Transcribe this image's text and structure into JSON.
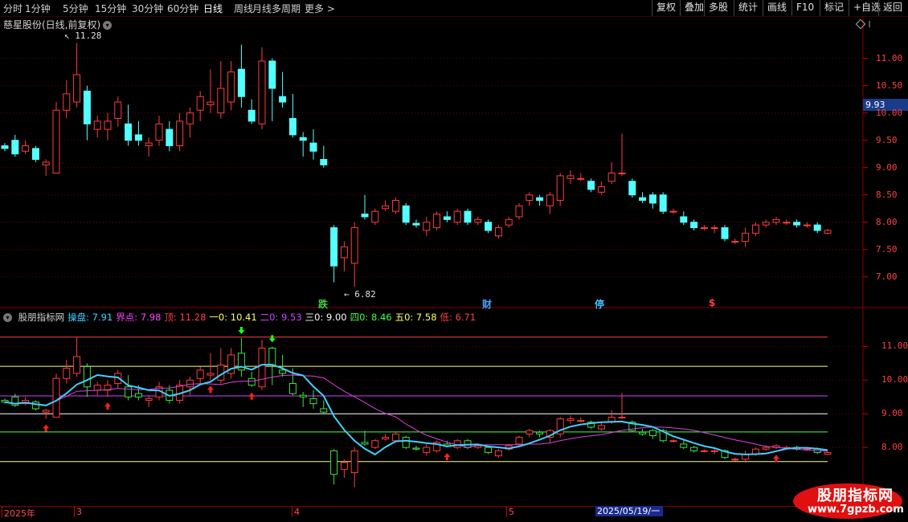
{
  "toolbar": {
    "periods": [
      "分时",
      "1分钟",
      "5分钟",
      "15分钟",
      "30分钟",
      "60分钟",
      "日线",
      "周线",
      "月线",
      "多周期",
      "更多 >"
    ],
    "active_period": "日线",
    "right_buttons": [
      "复权",
      "叠加",
      "多股",
      "统计",
      "画线",
      "F10",
      "标记",
      "+自选",
      "返回"
    ]
  },
  "main_chart": {
    "title": "慈星股份(日线,前复权)",
    "high_marker": "11.28",
    "low_marker": "6.82",
    "current_price": "9.93",
    "y_ticks": [
      "11.00",
      "10.50",
      "10.00",
      "9.50",
      "9.00",
      "8.50",
      "8.00",
      "7.50",
      "7.00"
    ],
    "events": [
      {
        "label": "跌",
        "color": "#40d040"
      },
      {
        "label": "财",
        "color": "#4aa0ff"
      },
      {
        "label": "停",
        "color": "#40c0ff"
      },
      {
        "label": "$",
        "color": "#ff4040"
      }
    ]
  },
  "indicator": {
    "name": "股朋指标网",
    "items": [
      {
        "label": "操盘:",
        "value": "7.91",
        "color": "#40d0ff"
      },
      {
        "label": "界点:",
        "value": "7.98",
        "color": "#ff40ff"
      },
      {
        "label": "顶:",
        "value": "11.28",
        "color": "#ff4040"
      },
      {
        "label": "一0:",
        "value": "10.41",
        "color": "#ffff60"
      },
      {
        "label": "二0:",
        "value": "9.53",
        "color": "#d040ff"
      },
      {
        "label": "三0:",
        "value": "9.00",
        "color": "#ffffff"
      },
      {
        "label": "四0:",
        "value": "8.46",
        "color": "#40ff40"
      },
      {
        "label": "五0:",
        "value": "7.58",
        "color": "#ffff60"
      },
      {
        "label": "低:",
        "value": "6.71",
        "color": "#ff4040"
      }
    ],
    "y_ticks": [
      "11.00",
      "10.00",
      "9.00",
      "8.00"
    ]
  },
  "date_axis": {
    "labels": [
      "2025年",
      "3",
      "4",
      "5"
    ],
    "highlight": "2025/05/19/一"
  },
  "watermark": {
    "text": "股朋指标网",
    "url": "www.7gpzb.com"
  },
  "chart_data": {
    "type": "candlestick",
    "candles": [
      [
        9.4,
        9.35,
        9.45,
        9.3
      ],
      [
        9.5,
        9.25,
        9.6,
        9.2
      ],
      [
        9.3,
        9.4,
        9.5,
        9.25
      ],
      [
        9.35,
        9.15,
        9.4,
        9.1
      ],
      [
        9.05,
        9.1,
        9.15,
        8.85
      ],
      [
        8.9,
        10.05,
        10.2,
        8.9
      ],
      [
        10.05,
        10.35,
        10.6,
        9.9
      ],
      [
        10.2,
        10.7,
        11.28,
        10.1
      ],
      [
        10.4,
        9.8,
        10.5,
        9.5
      ],
      [
        9.7,
        9.85,
        9.95,
        9.55
      ],
      [
        9.7,
        9.85,
        10.0,
        9.5
      ],
      [
        9.9,
        10.2,
        10.3,
        9.75
      ],
      [
        9.8,
        9.5,
        10.15,
        9.4
      ],
      [
        9.6,
        9.5,
        9.85,
        9.4
      ],
      [
        9.4,
        9.45,
        9.55,
        9.2
      ],
      [
        9.5,
        9.8,
        9.95,
        9.4
      ],
      [
        9.7,
        9.4,
        9.85,
        9.3
      ],
      [
        9.4,
        9.85,
        10.0,
        9.3
      ],
      [
        9.8,
        10.0,
        10.1,
        9.55
      ],
      [
        10.05,
        10.3,
        10.4,
        9.85
      ],
      [
        10.15,
        10.2,
        10.8,
        10.0
      ],
      [
        10.0,
        10.45,
        10.95,
        9.9
      ],
      [
        10.2,
        10.75,
        10.95,
        10.05
      ],
      [
        10.8,
        10.3,
        11.25,
        10.1
      ],
      [
        10.05,
        9.85,
        10.25,
        9.8
      ],
      [
        9.8,
        10.95,
        11.2,
        9.7
      ],
      [
        10.95,
        10.45,
        11.0,
        9.85
      ],
      [
        10.3,
        10.2,
        10.75,
        10.1
      ],
      [
        9.9,
        9.6,
        10.35,
        9.55
      ],
      [
        9.55,
        9.5,
        9.65,
        9.2
      ],
      [
        9.45,
        9.3,
        9.7,
        9.15
      ],
      [
        9.15,
        9.05,
        9.4,
        9.0
      ],
      [
        7.9,
        7.2,
        7.95,
        6.9
      ],
      [
        7.35,
        7.55,
        7.65,
        7.1
      ],
      [
        7.25,
        7.9,
        8.0,
        6.82
      ],
      [
        8.15,
        8.1,
        8.5,
        8.05
      ],
      [
        8.0,
        8.2,
        8.25,
        7.95
      ],
      [
        8.25,
        8.3,
        8.4,
        8.2
      ],
      [
        8.2,
        8.4,
        8.45,
        8.15
      ],
      [
        8.3,
        8.0,
        8.35,
        7.95
      ],
      [
        7.98,
        7.95,
        8.05,
        7.9
      ],
      [
        7.85,
        8.0,
        8.1,
        7.75
      ],
      [
        7.9,
        8.15,
        8.2,
        7.85
      ],
      [
        8.1,
        8.05,
        8.2,
        8.0
      ],
      [
        8.0,
        8.2,
        8.25,
        7.95
      ],
      [
        8.2,
        8.0,
        8.25,
        7.95
      ],
      [
        8.0,
        8.05,
        8.1,
        7.95
      ],
      [
        8.0,
        7.85,
        8.05,
        7.8
      ],
      [
        7.75,
        7.9,
        7.95,
        7.7
      ],
      [
        7.95,
        8.05,
        8.1,
        7.9
      ],
      [
        8.1,
        8.3,
        8.35,
        8.05
      ],
      [
        8.4,
        8.5,
        8.55,
        8.3
      ],
      [
        8.45,
        8.4,
        8.5,
        8.3
      ],
      [
        8.3,
        8.5,
        8.55,
        8.15
      ],
      [
        8.4,
        8.85,
        8.9,
        8.3
      ],
      [
        8.8,
        8.85,
        8.95,
        8.7
      ],
      [
        8.8,
        8.8,
        8.9,
        8.75
      ],
      [
        8.75,
        8.6,
        8.8,
        8.55
      ],
      [
        8.55,
        8.65,
        8.75,
        8.5
      ],
      [
        8.75,
        8.9,
        9.1,
        8.7
      ],
      [
        8.9,
        8.9,
        9.62,
        8.85
      ],
      [
        8.75,
        8.5,
        8.8,
        8.45
      ],
      [
        8.45,
        8.4,
        8.55,
        8.35
      ],
      [
        8.5,
        8.35,
        8.55,
        8.25
      ],
      [
        8.5,
        8.2,
        8.55,
        8.15
      ],
      [
        8.2,
        8.2,
        8.25,
        8.15
      ],
      [
        8.1,
        8.0,
        8.2,
        7.95
      ],
      [
        8.0,
        7.9,
        8.05,
        7.85
      ],
      [
        7.9,
        7.9,
        7.95,
        7.85
      ],
      [
        7.9,
        7.9,
        7.95,
        7.8
      ],
      [
        7.9,
        7.7,
        7.95,
        7.65
      ],
      [
        7.65,
        7.65,
        7.7,
        7.6
      ],
      [
        7.65,
        7.8,
        7.9,
        7.55
      ],
      [
        7.8,
        7.95,
        8.0,
        7.75
      ],
      [
        7.95,
        8.0,
        8.05,
        7.9
      ],
      [
        8.0,
        8.05,
        8.1,
        7.95
      ],
      [
        8.0,
        8.0,
        8.05,
        7.95
      ],
      [
        8.0,
        7.95,
        8.05,
        7.9
      ],
      [
        7.95,
        7.95,
        8.0,
        7.9
      ],
      [
        7.95,
        7.85,
        8.0,
        7.8
      ],
      [
        7.8,
        7.85,
        7.88,
        7.78
      ]
    ],
    "main_ylim": [
      6.6,
      11.45
    ],
    "ind_lines": {
      "top": 11.28,
      "l1": 10.41,
      "l2": 9.53,
      "l3": 9.0,
      "l4": 8.46,
      "l5": 7.58
    },
    "ind_ylim": [
      6.5,
      11.75
    ]
  }
}
